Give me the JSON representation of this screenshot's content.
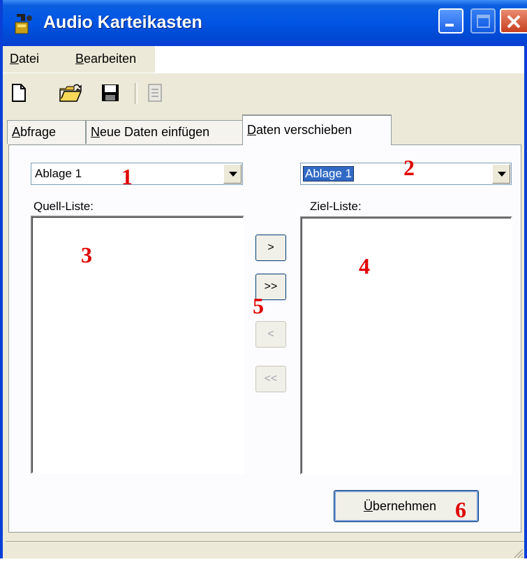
{
  "window": {
    "title": "Audio Karteikasten"
  },
  "menu": [
    {
      "accel": "D",
      "rest": "atei"
    },
    {
      "accel": "B",
      "rest": "earbeiten"
    }
  ],
  "toolbar": {
    "icons": [
      "new-file-icon",
      "open-folder-icon",
      "save-disk-icon",
      "print-disabled-icon"
    ]
  },
  "tabs": [
    {
      "accel": "A",
      "rest": "bfrage",
      "active": false
    },
    {
      "accel": "N",
      "rest": "eue Daten einfügen",
      "active": false
    },
    {
      "accel": "D",
      "rest": "aten verschieben",
      "active": true
    }
  ],
  "source": {
    "combo_value": "Ablage 1",
    "label": "Quell-Liste:"
  },
  "target": {
    "combo_value": "Ablage 1",
    "label": "Ziel-Liste:"
  },
  "move_buttons": [
    {
      "label": ">",
      "enabled": true
    },
    {
      "label": ">>",
      "enabled": true
    },
    {
      "label": "<",
      "enabled": false
    },
    {
      "label": "<<",
      "enabled": false
    }
  ],
  "apply_button": {
    "accel": "Ü",
    "rest": "bernehmen"
  },
  "annotations": [
    "1",
    "2",
    "3",
    "4",
    "5",
    "6"
  ],
  "colors": {
    "title_bar": "#0054e3",
    "annotation": "#e00000",
    "selection": "#316ac5"
  }
}
